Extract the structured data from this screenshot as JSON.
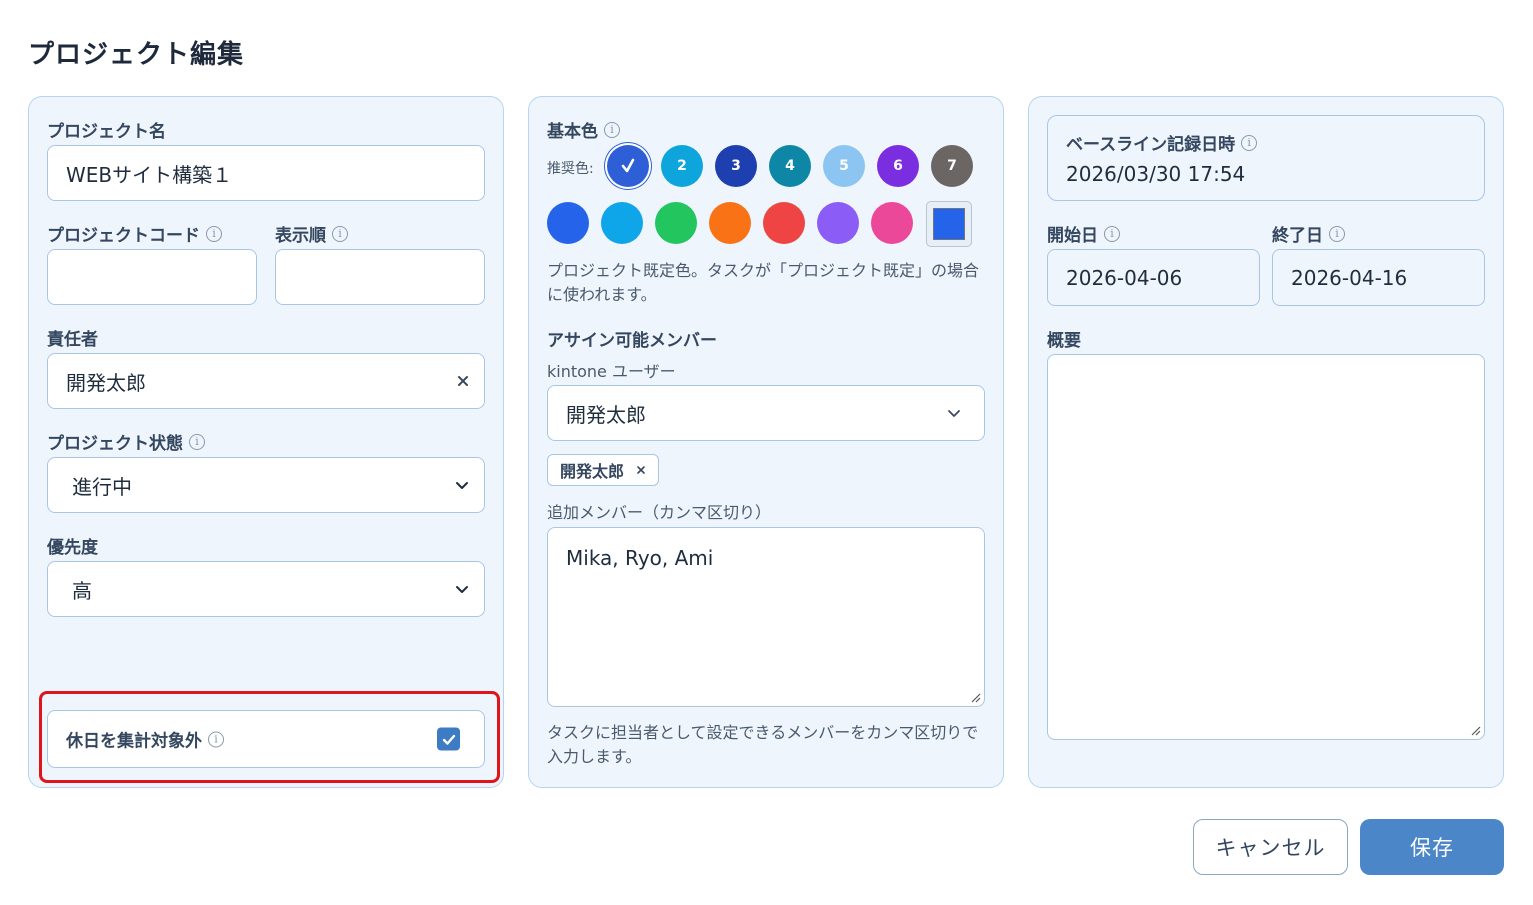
{
  "dialog": {
    "title": "プロジェクト編集"
  },
  "left": {
    "name_label": "プロジェクト名",
    "name_value": "WEBサイト構築１",
    "code_label": "プロジェクトコード",
    "code_value": "",
    "order_label": "表示順",
    "order_value": "",
    "owner_label": "責任者",
    "owner_value": "開発太郎",
    "status_label": "プロジェクト状態",
    "status_value": "進行中",
    "priority_label": "優先度",
    "priority_value": "高",
    "holiday_label": "休日を集計対象外",
    "holiday_checked": true
  },
  "middle": {
    "color_label": "基本色",
    "recommended_label": "推奨色:",
    "recommended": [
      {
        "label": "",
        "color": "#2f5fd6",
        "selected": true
      },
      {
        "label": "2",
        "color": "#0ea5dc"
      },
      {
        "label": "3",
        "color": "#1e3fb0"
      },
      {
        "label": "4",
        "color": "#0e87a6"
      },
      {
        "label": "5",
        "color": "#8cc4f2"
      },
      {
        "label": "6",
        "color": "#7a2ee0"
      },
      {
        "label": "7",
        "color": "#6b6663"
      }
    ],
    "palette": [
      "#2563eb",
      "#0ea5e9",
      "#22c55e",
      "#f97316",
      "#ef4444",
      "#8b5cf6",
      "#ec4899"
    ],
    "custom_color": "#2563eb",
    "color_help": "プロジェクト既定色。タスクが「プロジェクト既定」の場合に使われます。",
    "members_label": "アサイン可能メンバー",
    "kintone_label": "kintone ユーザー",
    "kintone_value": "開発太郎",
    "chip_label": "開発太郎",
    "extra_label": "追加メンバー（カンマ区切り）",
    "extra_value": "Mika, Ryo, Ami",
    "extra_help": "タスクに担当者として設定できるメンバーをカンマ区切りで入力します。"
  },
  "right": {
    "baseline_label": "ベースライン記録日時",
    "baseline_value": "2026/03/30 17:54",
    "start_label": "開始日",
    "start_value": "2026-04-06",
    "end_label": "終了日",
    "end_value": "2026-04-16",
    "summary_label": "概要",
    "summary_value": ""
  },
  "footer": {
    "cancel_label": "キャンセル",
    "save_label": "保存"
  },
  "colors": {
    "accent": "#4a86c8",
    "highlight": "#e0141b",
    "panel_bg": "#eef5fd",
    "border": "#a9c6e6"
  }
}
